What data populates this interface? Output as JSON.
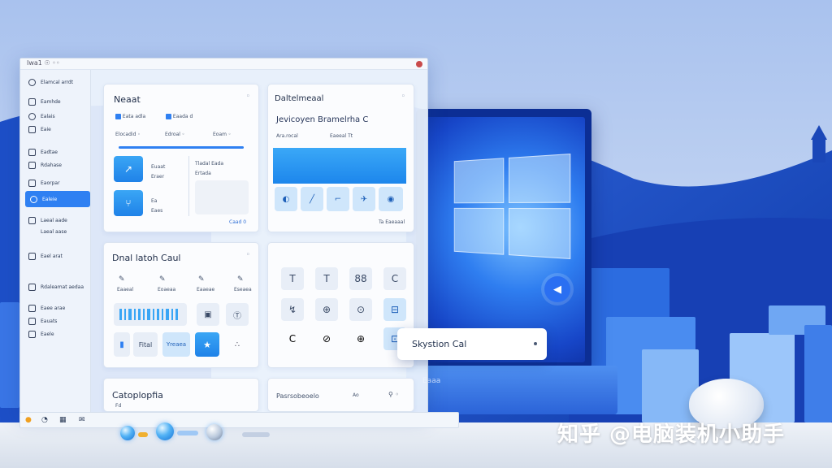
{
  "window": {
    "title": "Iwa1 ☉ ◦◦"
  },
  "sidebar": {
    "items": [
      {
        "label": "Elamcal arrdt",
        "icon": "home-icon"
      },
      {
        "label": "Eamhde",
        "icon": "folder-icon"
      },
      {
        "label": "Ealais",
        "icon": "gear-icon"
      },
      {
        "label": "Eaie",
        "icon": "user-icon"
      },
      {
        "label": "Eadtae",
        "icon": "chart-icon"
      },
      {
        "label": "Rdahase",
        "icon": "document-icon"
      },
      {
        "label": "Eaorpar",
        "icon": "layers-icon"
      },
      {
        "label": "Ealeie",
        "icon": "grid-icon"
      },
      {
        "label": "Laeal aade",
        "icon": "monitor-icon"
      },
      {
        "label": "Laeal aase",
        "icon": "lock-icon"
      },
      {
        "label": "Eael arat",
        "icon": "settings-icon"
      },
      {
        "label": "Rdaleamat aedaa",
        "icon": "phone-icon"
      },
      {
        "label": "Eaee arae",
        "icon": "network-icon"
      },
      {
        "label": "Eauats",
        "icon": "shield-icon"
      },
      {
        "label": "Eaele",
        "icon": "box-icon"
      }
    ],
    "active_index": 7
  },
  "card1": {
    "title": "Neaat",
    "dots": "◦",
    "chips": [
      "Eata adla",
      "Eaada d"
    ],
    "subtabs": [
      "Elocadid ◦",
      "Edroal ◦",
      "Eoam ◦"
    ],
    "tiles": [
      {
        "label": "Euaat",
        "sub": "Eraer"
      },
      {
        "label": "Ea",
        "sub": "Eaes"
      }
    ],
    "right_label": "Tladal Eada",
    "right_sub": "Ertada",
    "footer": "Caad 0"
  },
  "card2": {
    "title": "Daltelmeaal",
    "subtitle": "Jevicoyen Bramelrha C",
    "row": [
      "Ara.rocal",
      "Eaeeal Tt"
    ],
    "footer": "Ta  Eaeaaal"
  },
  "card3": {
    "title": "Dnal latoh Caul",
    "labels": [
      "Eaaeal",
      "Eoaeaa",
      "Eaaeae",
      "Eseaea"
    ],
    "bottom": [
      "Fital",
      "Yreaea"
    ]
  },
  "card4": {
    "tiles": [
      "T",
      "T",
      "88",
      "C",
      "↯",
      "⊕",
      "⊙",
      "⊟",
      "C",
      "⊘",
      "⊕",
      "⊡"
    ]
  },
  "card5": {
    "title": "Catoplopfia",
    "sub": "Fd"
  },
  "card6": {
    "title": "Pasrsobeoelo",
    "right": "Ao"
  },
  "popup": {
    "label": "Skystion Cal"
  },
  "monitor": {
    "brand": "Eaaa"
  },
  "watermark": "知乎 @电脑装机小助手",
  "colors": {
    "accent": "#2f80f2",
    "deep_blue": "#0c2e94",
    "panel": "#fbfcfe"
  }
}
